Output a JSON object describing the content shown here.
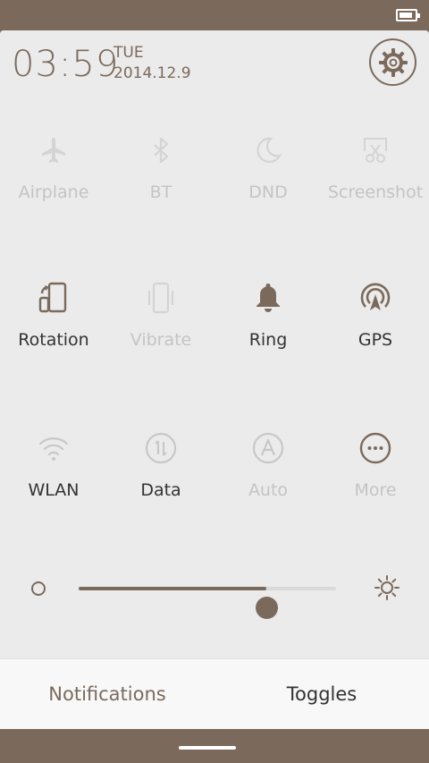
{
  "clock": {
    "time": "03:59",
    "day": "TUE",
    "date": "2014.12.9"
  },
  "battery": {
    "level": 0.85
  },
  "colors": {
    "accent": "#7b6a5c",
    "inactive": "#c4c4c4",
    "active_text": "#333333",
    "panel": "#ebebeb"
  },
  "toggles": [
    {
      "label": "Airplane",
      "icon": "airplane-icon",
      "state": "off"
    },
    {
      "label": "BT",
      "icon": "bluetooth-icon",
      "state": "off"
    },
    {
      "label": "DND",
      "icon": "moon-icon",
      "state": "off"
    },
    {
      "label": "Screenshot",
      "icon": "screenshot-icon",
      "state": "off"
    },
    {
      "label": "Rotation",
      "icon": "rotation-icon",
      "state": "on"
    },
    {
      "label": "Vibrate",
      "icon": "vibrate-icon",
      "state": "off"
    },
    {
      "label": "Ring",
      "icon": "bell-icon",
      "state": "on"
    },
    {
      "label": "GPS",
      "icon": "gps-icon",
      "state": "on"
    },
    {
      "label": "WLAN",
      "icon": "wifi-icon",
      "state": "off"
    },
    {
      "label": "Data",
      "icon": "data-icon",
      "state": "off"
    },
    {
      "label": "Auto",
      "icon": "auto-brightness-icon",
      "state": "off"
    },
    {
      "label": "More",
      "icon": "more-icon",
      "state": "on"
    }
  ],
  "brightness": {
    "level": 0.73
  },
  "tabs": {
    "notifications": "Notifications",
    "toggles": "Toggles",
    "active": "toggles"
  }
}
